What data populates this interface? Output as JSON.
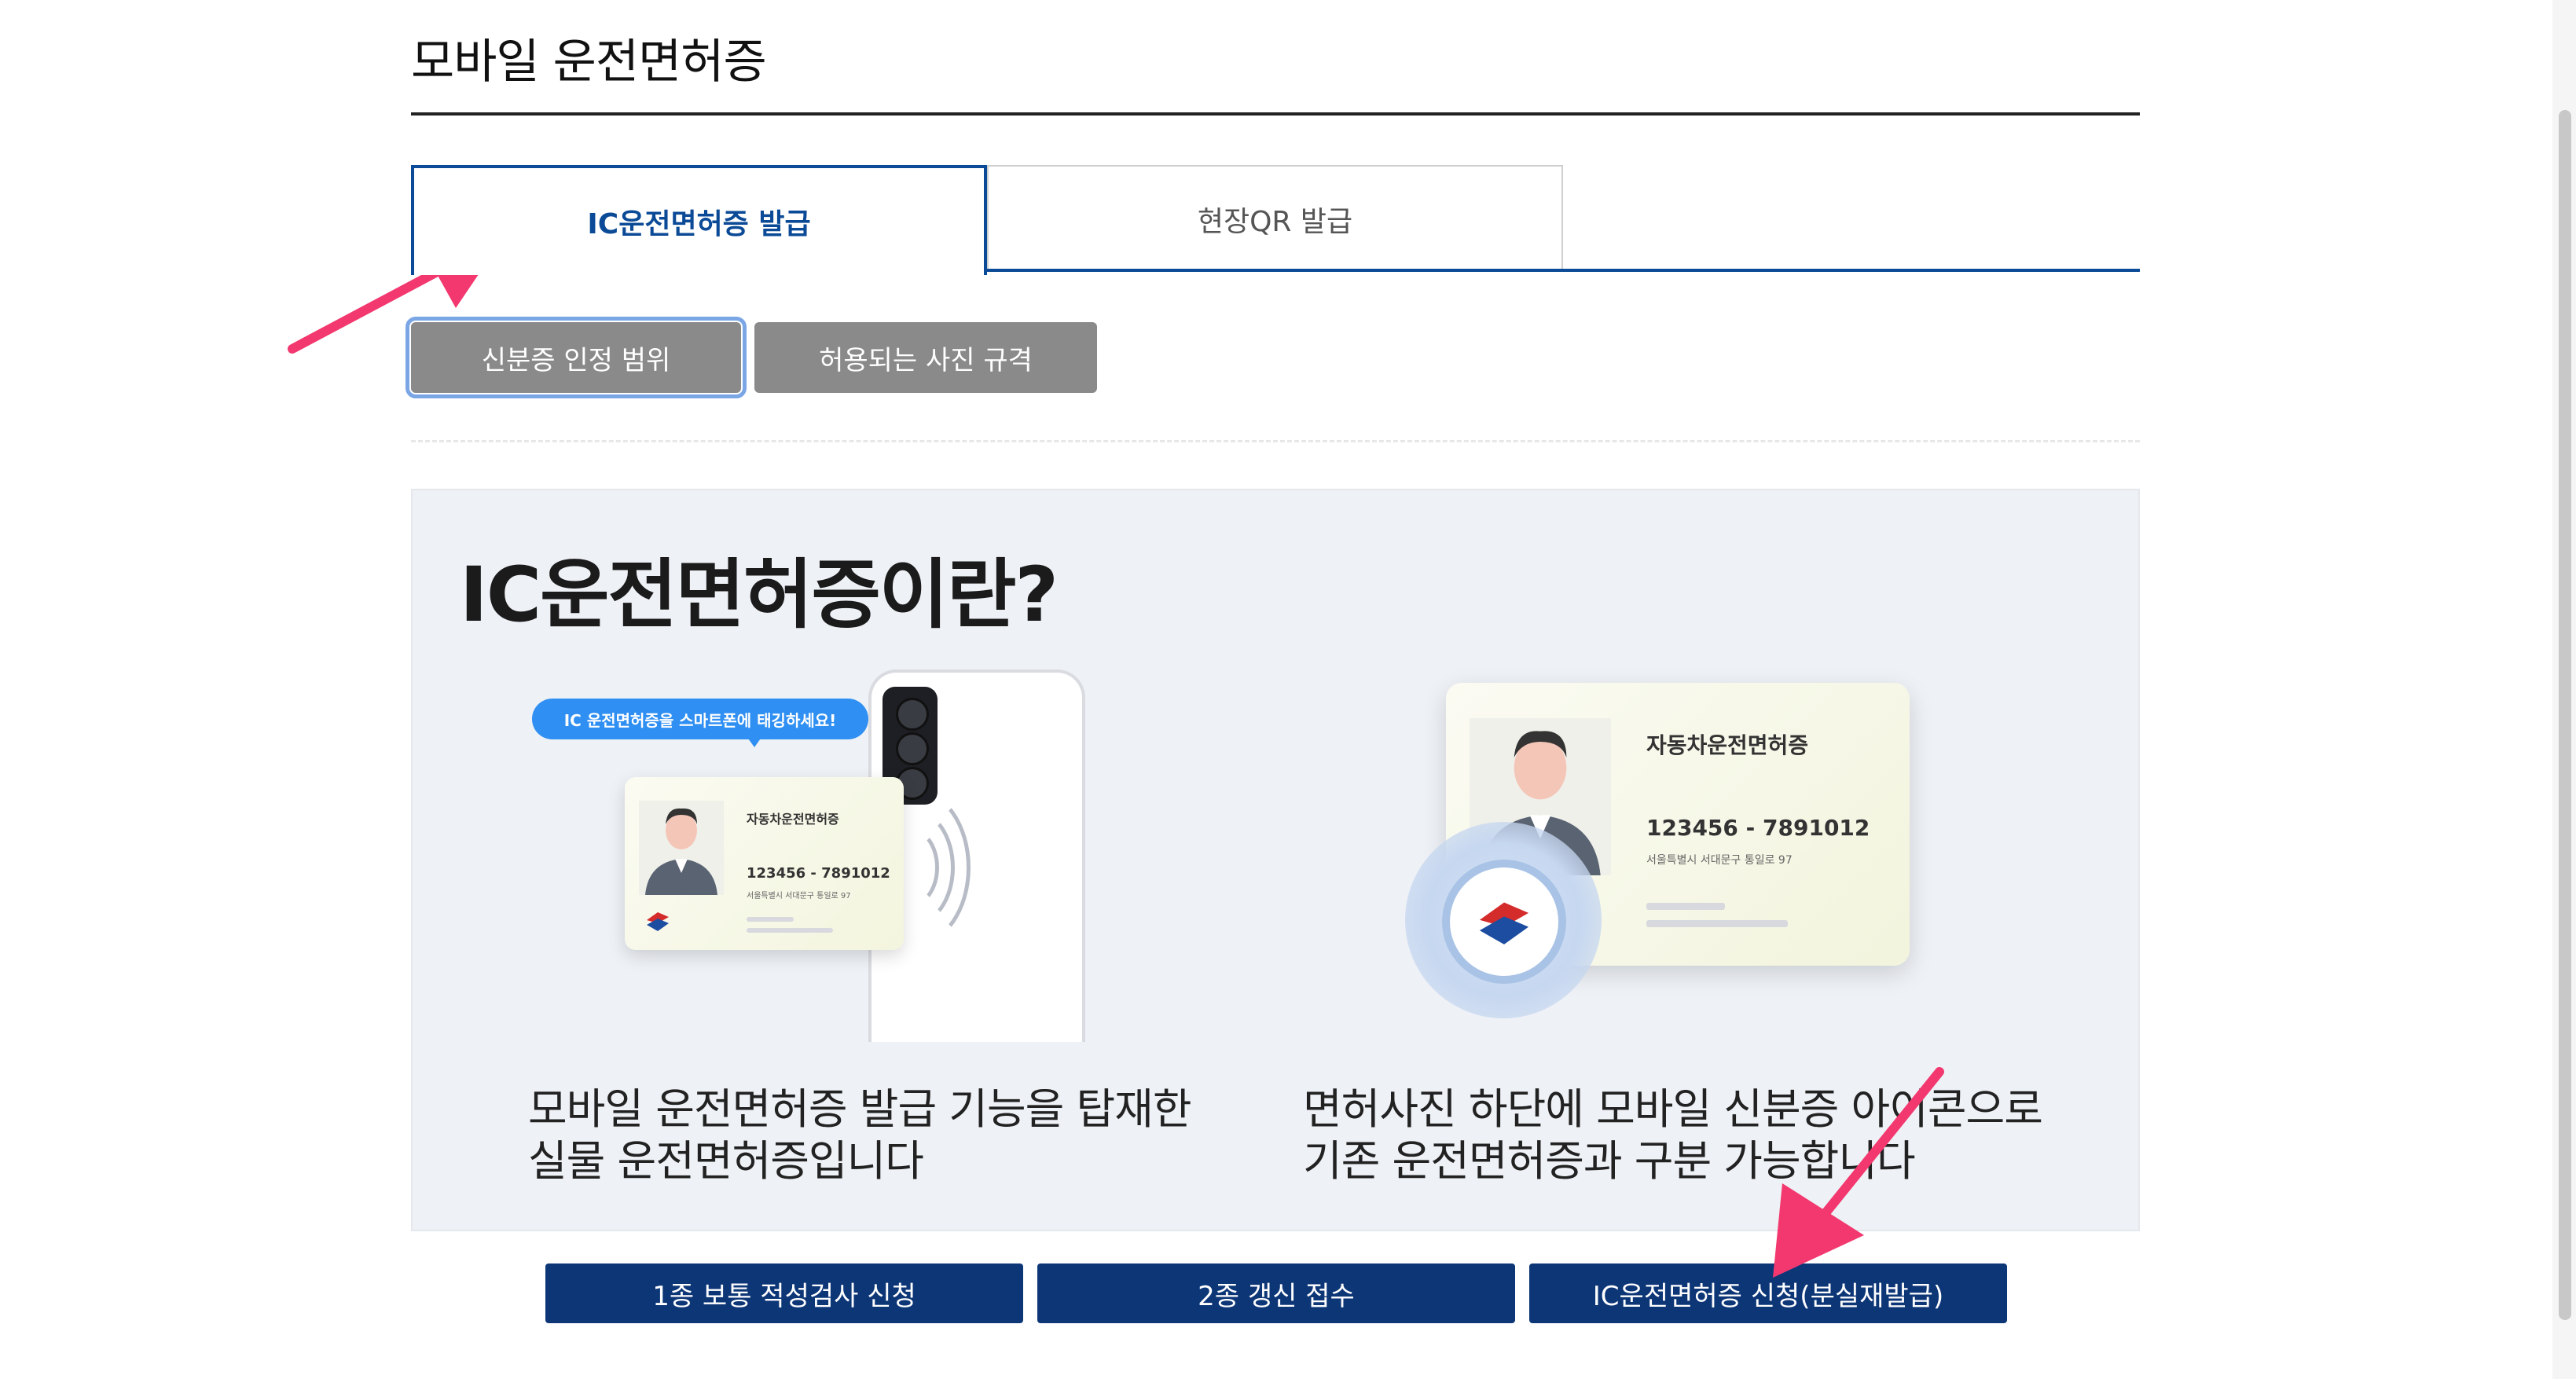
{
  "page": {
    "title": "모바일 운전면허증"
  },
  "tabs": [
    {
      "label": "IC운전면허증 발급",
      "active": true
    },
    {
      "label": "현장QR 발급",
      "active": false
    }
  ],
  "sub_buttons": [
    {
      "label": "신분증 인정 범위"
    },
    {
      "label": "허용되는 사진 규격"
    }
  ],
  "panel": {
    "heading": "IC운전면허증이란?",
    "bubble_text": "IC 운전면허증을 스마트폰에 태깅하세요!",
    "card_small": {
      "title": "자동차운전면허증",
      "number": "123456 - 7891012",
      "address": "서울특별시 서대문구 통일로 97"
    },
    "card_large": {
      "title": "자동차운전면허증",
      "number": "123456 - 7891012",
      "address": "서울특별시 서대문구 통일로 97"
    },
    "caption_left": "모바일 운전면허증 발급 기능을 탑재한\n실물 운전면허증입니다",
    "caption_right": "면허사진 하단에 모바일 신분증 아이콘으로\n기존 운전면허증과 구분 가능합니다"
  },
  "bottom_buttons": [
    {
      "label": "1종 보통 적성검사 신청"
    },
    {
      "label": "2종 갱신 접수"
    },
    {
      "label": "IC운전면허증 신청(분실재발급)"
    }
  ],
  "colors": {
    "accent": "#0b4a96",
    "button_dark": "#0d3677",
    "sub_button": "#8a8a8a",
    "arrow": "#f2386f",
    "panel_bg": "#eef1f6"
  }
}
